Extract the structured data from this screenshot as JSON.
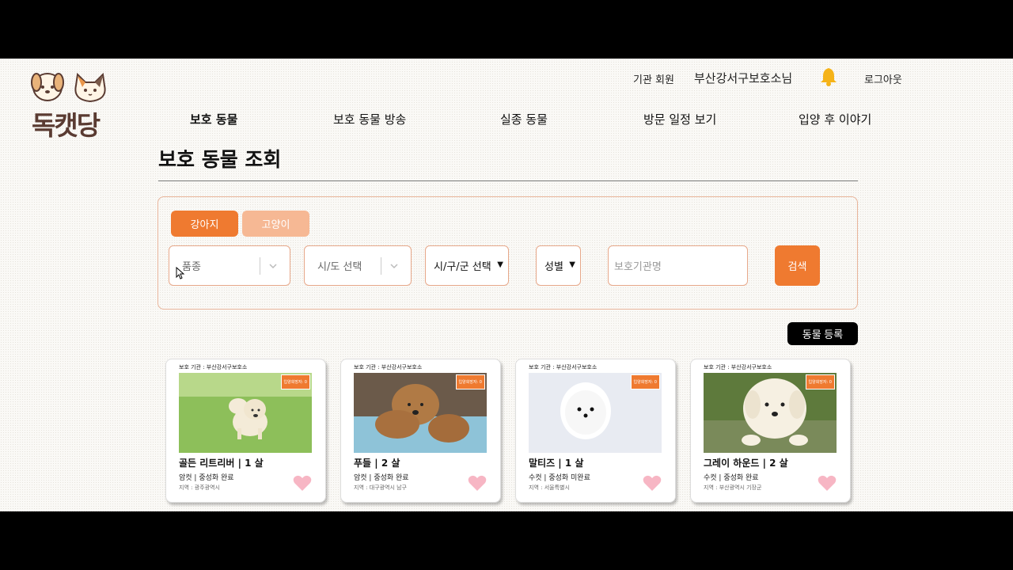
{
  "logo": {
    "text": "독캣당"
  },
  "topbar": {
    "org_type": "기관 회원",
    "user_name": "부산강서구보호소님",
    "logout": "로그아웃"
  },
  "nav": [
    "보호 동물",
    "보호 동물 방송",
    "실종 동물",
    "방문 일정 보기",
    "입양 후 이야기"
  ],
  "page_title": "보호 동물 조회",
  "filters": {
    "tab_dog": "강아지",
    "tab_cat": "고양이",
    "breed_placeholder": "품종",
    "sido_placeholder": "시/도 선택",
    "sigungu_value": "시/구/군 선택",
    "gender_value": "성별",
    "org_placeholder": "보호기관명",
    "search": "검색"
  },
  "register_button": "동물 등록",
  "cards": [
    {
      "org": "보호 기관 : 부산강서구보호소",
      "badge": "입양희망자: 0",
      "name": "골든 리트리버 | 1 살",
      "meta": "암컷 | 중성화 완료",
      "region": "지역 : 광주광역시"
    },
    {
      "org": "보호 기관 : 부산강서구보호소",
      "badge": "입양희망자: 0",
      "name": "푸들 | 2 살",
      "meta": "암컷 | 중성화 완료",
      "region": "지역 : 대구광역시 남구"
    },
    {
      "org": "보호 기관 : 부산강서구보호소",
      "badge": "입양희망자: 0",
      "name": "말티즈 | 1 살",
      "meta": "수컷 | 중성화 미완료",
      "region": "지역 : 서울특별시"
    },
    {
      "org": "보호 기관 : 부산강서구보호소",
      "badge": "입양희망자: 0",
      "name": "그레이 하운드 | 2 살",
      "meta": "수컷 | 중성화 완료",
      "region": "지역 : 부산광역시 기장군"
    }
  ],
  "colors": {
    "accent": "#ef7a30",
    "accent_light": "#f6b894",
    "heart": "#f7b6c4"
  }
}
